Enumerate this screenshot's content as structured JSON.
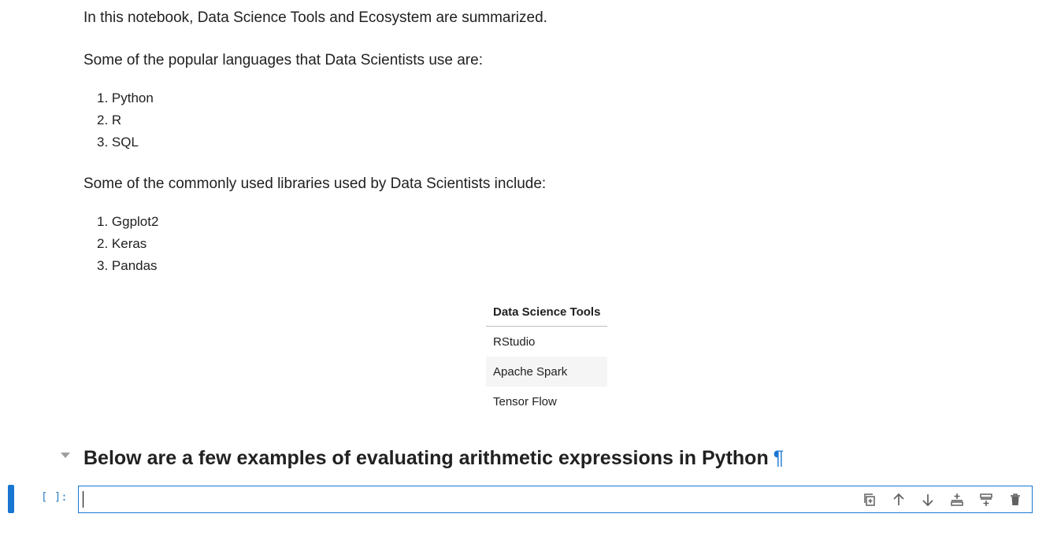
{
  "notebook": {
    "intro": "In this notebook, Data Science Tools and Ecosystem are summarized.",
    "languages_intro": "Some of the popular languages that Data Scientists use are:",
    "languages": [
      "1. Python",
      "2. R",
      "3. SQL"
    ],
    "libraries_intro": "Some of the commonly used libraries used by Data Scientists include:",
    "libraries": [
      "1. Ggplot2",
      "2. Keras",
      "3. Pandas"
    ],
    "tools_table": {
      "header": "Data Science Tools",
      "rows": [
        "RStudio",
        "Apache Spark",
        "Tensor Flow"
      ]
    },
    "section_heading": "Below are a few examples of evaluating arithmetic expressions in Python",
    "anchor_symbol": "¶",
    "code_cell": {
      "prompt": "[ ]:",
      "value": ""
    }
  },
  "cell_toolbar_icons": [
    "duplicate-icon",
    "move-up-icon",
    "move-down-icon",
    "insert-above-icon",
    "insert-below-icon",
    "delete-icon"
  ],
  "colors": {
    "accent": "#1976d2",
    "prompt": "#307fc1",
    "table_alt_row": "#f5f5f5"
  }
}
